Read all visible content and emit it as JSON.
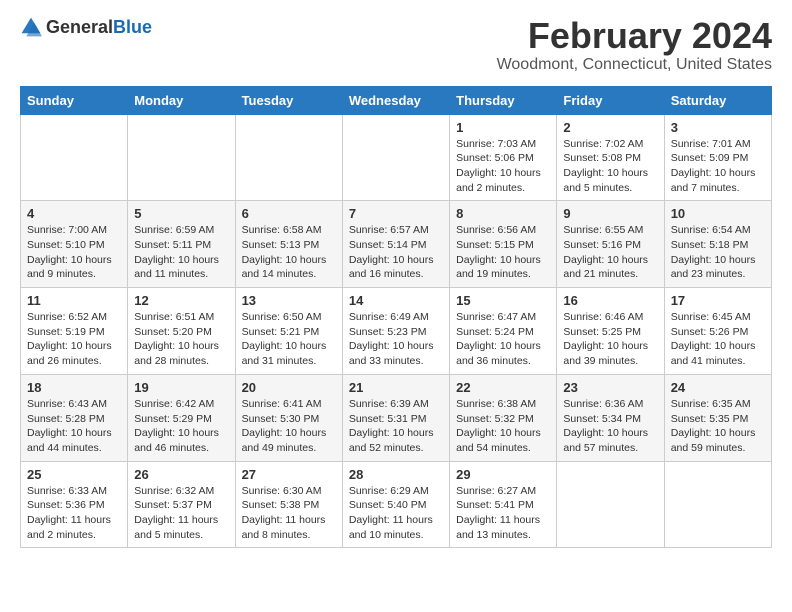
{
  "logo": {
    "text_general": "General",
    "text_blue": "Blue"
  },
  "title": {
    "month": "February 2024",
    "location": "Woodmont, Connecticut, United States"
  },
  "headers": [
    "Sunday",
    "Monday",
    "Tuesday",
    "Wednesday",
    "Thursday",
    "Friday",
    "Saturday"
  ],
  "weeks": [
    [
      {
        "day": "",
        "info": ""
      },
      {
        "day": "",
        "info": ""
      },
      {
        "day": "",
        "info": ""
      },
      {
        "day": "",
        "info": ""
      },
      {
        "day": "1",
        "info": "Sunrise: 7:03 AM\nSunset: 5:06 PM\nDaylight: 10 hours\nand 2 minutes."
      },
      {
        "day": "2",
        "info": "Sunrise: 7:02 AM\nSunset: 5:08 PM\nDaylight: 10 hours\nand 5 minutes."
      },
      {
        "day": "3",
        "info": "Sunrise: 7:01 AM\nSunset: 5:09 PM\nDaylight: 10 hours\nand 7 minutes."
      }
    ],
    [
      {
        "day": "4",
        "info": "Sunrise: 7:00 AM\nSunset: 5:10 PM\nDaylight: 10 hours\nand 9 minutes."
      },
      {
        "day": "5",
        "info": "Sunrise: 6:59 AM\nSunset: 5:11 PM\nDaylight: 10 hours\nand 11 minutes."
      },
      {
        "day": "6",
        "info": "Sunrise: 6:58 AM\nSunset: 5:13 PM\nDaylight: 10 hours\nand 14 minutes."
      },
      {
        "day": "7",
        "info": "Sunrise: 6:57 AM\nSunset: 5:14 PM\nDaylight: 10 hours\nand 16 minutes."
      },
      {
        "day": "8",
        "info": "Sunrise: 6:56 AM\nSunset: 5:15 PM\nDaylight: 10 hours\nand 19 minutes."
      },
      {
        "day": "9",
        "info": "Sunrise: 6:55 AM\nSunset: 5:16 PM\nDaylight: 10 hours\nand 21 minutes."
      },
      {
        "day": "10",
        "info": "Sunrise: 6:54 AM\nSunset: 5:18 PM\nDaylight: 10 hours\nand 23 minutes."
      }
    ],
    [
      {
        "day": "11",
        "info": "Sunrise: 6:52 AM\nSunset: 5:19 PM\nDaylight: 10 hours\nand 26 minutes."
      },
      {
        "day": "12",
        "info": "Sunrise: 6:51 AM\nSunset: 5:20 PM\nDaylight: 10 hours\nand 28 minutes."
      },
      {
        "day": "13",
        "info": "Sunrise: 6:50 AM\nSunset: 5:21 PM\nDaylight: 10 hours\nand 31 minutes."
      },
      {
        "day": "14",
        "info": "Sunrise: 6:49 AM\nSunset: 5:23 PM\nDaylight: 10 hours\nand 33 minutes."
      },
      {
        "day": "15",
        "info": "Sunrise: 6:47 AM\nSunset: 5:24 PM\nDaylight: 10 hours\nand 36 minutes."
      },
      {
        "day": "16",
        "info": "Sunrise: 6:46 AM\nSunset: 5:25 PM\nDaylight: 10 hours\nand 39 minutes."
      },
      {
        "day": "17",
        "info": "Sunrise: 6:45 AM\nSunset: 5:26 PM\nDaylight: 10 hours\nand 41 minutes."
      }
    ],
    [
      {
        "day": "18",
        "info": "Sunrise: 6:43 AM\nSunset: 5:28 PM\nDaylight: 10 hours\nand 44 minutes."
      },
      {
        "day": "19",
        "info": "Sunrise: 6:42 AM\nSunset: 5:29 PM\nDaylight: 10 hours\nand 46 minutes."
      },
      {
        "day": "20",
        "info": "Sunrise: 6:41 AM\nSunset: 5:30 PM\nDaylight: 10 hours\nand 49 minutes."
      },
      {
        "day": "21",
        "info": "Sunrise: 6:39 AM\nSunset: 5:31 PM\nDaylight: 10 hours\nand 52 minutes."
      },
      {
        "day": "22",
        "info": "Sunrise: 6:38 AM\nSunset: 5:32 PM\nDaylight: 10 hours\nand 54 minutes."
      },
      {
        "day": "23",
        "info": "Sunrise: 6:36 AM\nSunset: 5:34 PM\nDaylight: 10 hours\nand 57 minutes."
      },
      {
        "day": "24",
        "info": "Sunrise: 6:35 AM\nSunset: 5:35 PM\nDaylight: 10 hours\nand 59 minutes."
      }
    ],
    [
      {
        "day": "25",
        "info": "Sunrise: 6:33 AM\nSunset: 5:36 PM\nDaylight: 11 hours\nand 2 minutes."
      },
      {
        "day": "26",
        "info": "Sunrise: 6:32 AM\nSunset: 5:37 PM\nDaylight: 11 hours\nand 5 minutes."
      },
      {
        "day": "27",
        "info": "Sunrise: 6:30 AM\nSunset: 5:38 PM\nDaylight: 11 hours\nand 8 minutes."
      },
      {
        "day": "28",
        "info": "Sunrise: 6:29 AM\nSunset: 5:40 PM\nDaylight: 11 hours\nand 10 minutes."
      },
      {
        "day": "29",
        "info": "Sunrise: 6:27 AM\nSunset: 5:41 PM\nDaylight: 11 hours\nand 13 minutes."
      },
      {
        "day": "",
        "info": ""
      },
      {
        "day": "",
        "info": ""
      }
    ]
  ]
}
